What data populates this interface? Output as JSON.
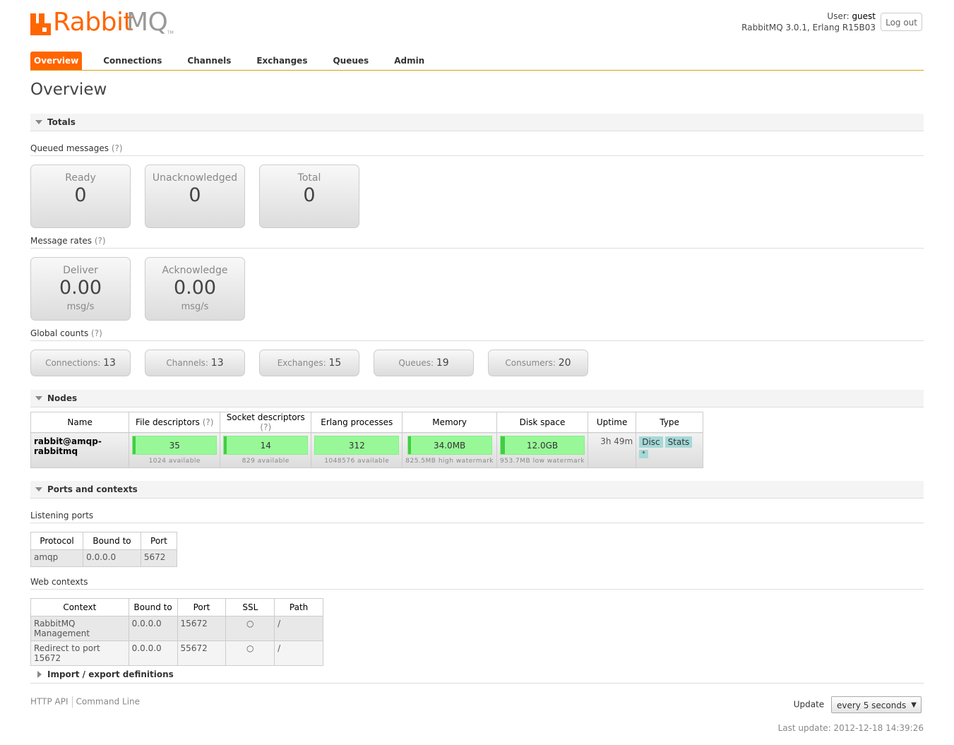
{
  "header": {
    "logo_text_1": "Rabbit",
    "logo_text_2": "MQ",
    "logo_tm": "TM",
    "user_label": "User:",
    "user_name": "guest",
    "version": "RabbitMQ 3.0.1, Erlang R15B03",
    "logout_label": "Log out"
  },
  "tabs": [
    "Overview",
    "Connections",
    "Channels",
    "Exchanges",
    "Queues",
    "Admin"
  ],
  "page_title": "Overview",
  "totals": {
    "section_label": "Totals",
    "queued_label": "Queued messages",
    "help": "(?)",
    "queued": [
      {
        "label": "Ready",
        "value": "0"
      },
      {
        "label": "Unacknowledged",
        "value": "0"
      },
      {
        "label": "Total",
        "value": "0"
      }
    ],
    "rates_label": "Message rates",
    "rates": [
      {
        "label": "Deliver",
        "value": "0.00",
        "unit": "msg/s"
      },
      {
        "label": "Acknowledge",
        "value": "0.00",
        "unit": "msg/s"
      }
    ],
    "global_label": "Global counts",
    "global": [
      {
        "label": "Connections:",
        "value": "13"
      },
      {
        "label": "Channels:",
        "value": "13"
      },
      {
        "label": "Exchanges:",
        "value": "15"
      },
      {
        "label": "Queues:",
        "value": "19"
      },
      {
        "label": "Consumers:",
        "value": "20"
      }
    ]
  },
  "nodes": {
    "section_label": "Nodes",
    "headers": [
      "Name",
      "File descriptors",
      "Socket descriptors",
      "Erlang processes",
      "Memory",
      "Disk space",
      "Uptime",
      "Type"
    ],
    "help": "(?)",
    "row": {
      "name": "rabbit@amqp-rabbitmq",
      "fd": {
        "value": "35",
        "sub": "1024 available"
      },
      "sd": {
        "value": "14",
        "sub": "829 available"
      },
      "proc": {
        "value": "312",
        "sub": "1048576 available"
      },
      "mem": {
        "value": "34.0MB",
        "sub": "825.5MB high watermark"
      },
      "disk": {
        "value": "12.0GB",
        "sub": "953.7MB low watermark"
      },
      "uptime": "3h 49m",
      "types": [
        "Disc",
        "Stats",
        "*"
      ]
    }
  },
  "ports": {
    "section_label": "Ports and contexts",
    "listening_label": "Listening ports",
    "listening_headers": [
      "Protocol",
      "Bound to",
      "Port"
    ],
    "listening_rows": [
      [
        "amqp",
        "0.0.0.0",
        "5672"
      ]
    ],
    "web_label": "Web contexts",
    "web_headers": [
      "Context",
      "Bound to",
      "Port",
      "SSL",
      "Path"
    ],
    "web_rows": [
      [
        "RabbitMQ Management",
        "0.0.0.0",
        "15672",
        "○",
        "/"
      ],
      [
        "Redirect to port 15672",
        "0.0.0.0",
        "55672",
        "○",
        "/"
      ]
    ]
  },
  "import_export": {
    "section_label": "Import / export definitions"
  },
  "footer": {
    "links": [
      "HTTP API",
      "Command Line"
    ],
    "update_label": "Update",
    "update_value": "every 5 seconds",
    "last_update": "Last update: 2012-12-18 14:39:26"
  }
}
